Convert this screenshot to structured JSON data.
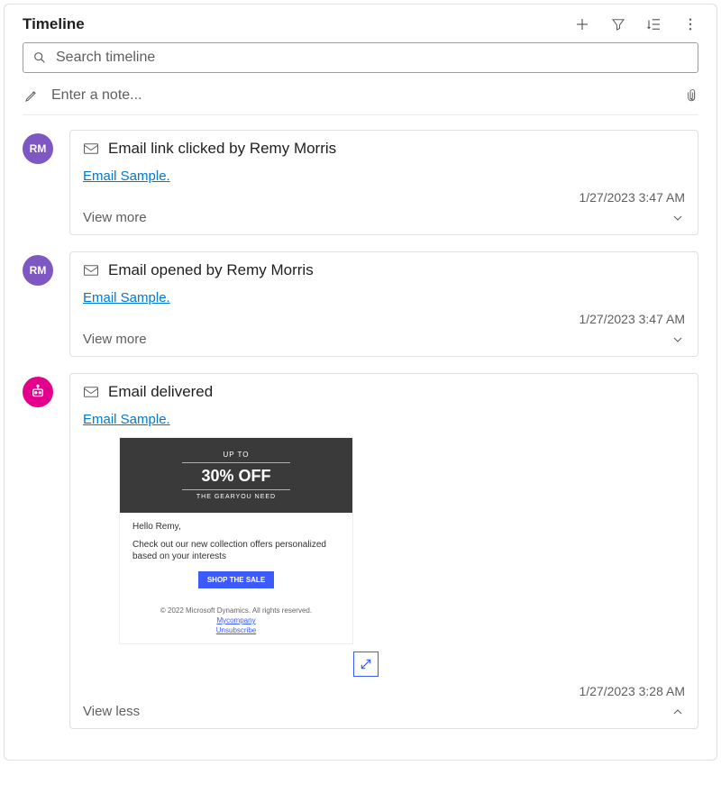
{
  "header": {
    "title": "Timeline",
    "search_placeholder": "Search timeline",
    "note_placeholder": "Enter a note..."
  },
  "entries": [
    {
      "avatar_initials": "RM",
      "avatar_type": "purple",
      "title": "Email link clicked by Remy Morris",
      "link_label": "Email Sample.",
      "timestamp": "1/27/2023 3:47 AM",
      "expand_label": "View more",
      "expanded": false
    },
    {
      "avatar_initials": "RM",
      "avatar_type": "purple",
      "title": "Email opened by Remy Morris",
      "link_label": "Email Sample.",
      "timestamp": "1/27/2023 3:47 AM",
      "expand_label": "View more",
      "expanded": false
    },
    {
      "avatar_initials": "",
      "avatar_type": "pink_bot",
      "title": "Email delivered",
      "link_label": "Email Sample.",
      "timestamp": "1/27/2023 3:28 AM",
      "expand_label": "View less",
      "expanded": true,
      "preview": {
        "upto": "UP TO",
        "pct": "30% OFF",
        "gear": "THE GEARYOU NEED",
        "greeting": "Hello Remy,",
        "message": "Check out our new collection offers personalized based on your interests",
        "cta": "SHOP THE SALE",
        "copyright": "© 2022 Microsoft Dynamics. All rights reserved.",
        "company_link": "Mycompany",
        "unsub_link": "Unsubscribe"
      }
    }
  ]
}
